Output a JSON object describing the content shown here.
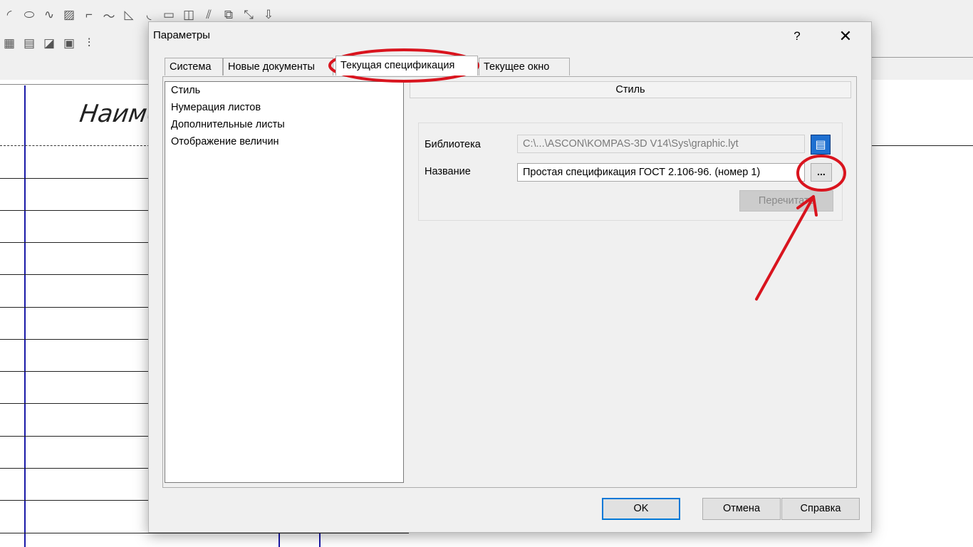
{
  "dialog": {
    "title": "Параметры",
    "help": "?",
    "close": "✕",
    "tabs": [
      {
        "label": "Система"
      },
      {
        "label": "Новые документы"
      },
      {
        "label": "Текущая спецификация"
      },
      {
        "label": "Текущее окно"
      }
    ],
    "active_tab": 2,
    "tree": {
      "items": [
        {
          "label": "Стиль"
        },
        {
          "label": "Нумерация листов"
        },
        {
          "label": "Дополнительные листы"
        },
        {
          "label": "Отображение величин"
        }
      ]
    },
    "section_header": "Стиль",
    "library": {
      "label": "Библиотека",
      "value": "C:\\...\\ASCON\\KOMPAS-3D V14\\Sys\\graphic.lyt"
    },
    "name_field": {
      "label": "Название",
      "value": "Простая спецификация ГОСТ 2.106-96. (номер 1)"
    },
    "browse_button": "...",
    "reread_button": "Перечитать",
    "buttons": {
      "ok": "OK",
      "cancel": "Отмена",
      "help": "Справка"
    }
  },
  "background": {
    "drawing_text": "Наименование"
  },
  "colors": {
    "annotation": "#d9141e",
    "drawing_line_blue": "#1a1aa8",
    "default_button_border": "#0078d7"
  }
}
